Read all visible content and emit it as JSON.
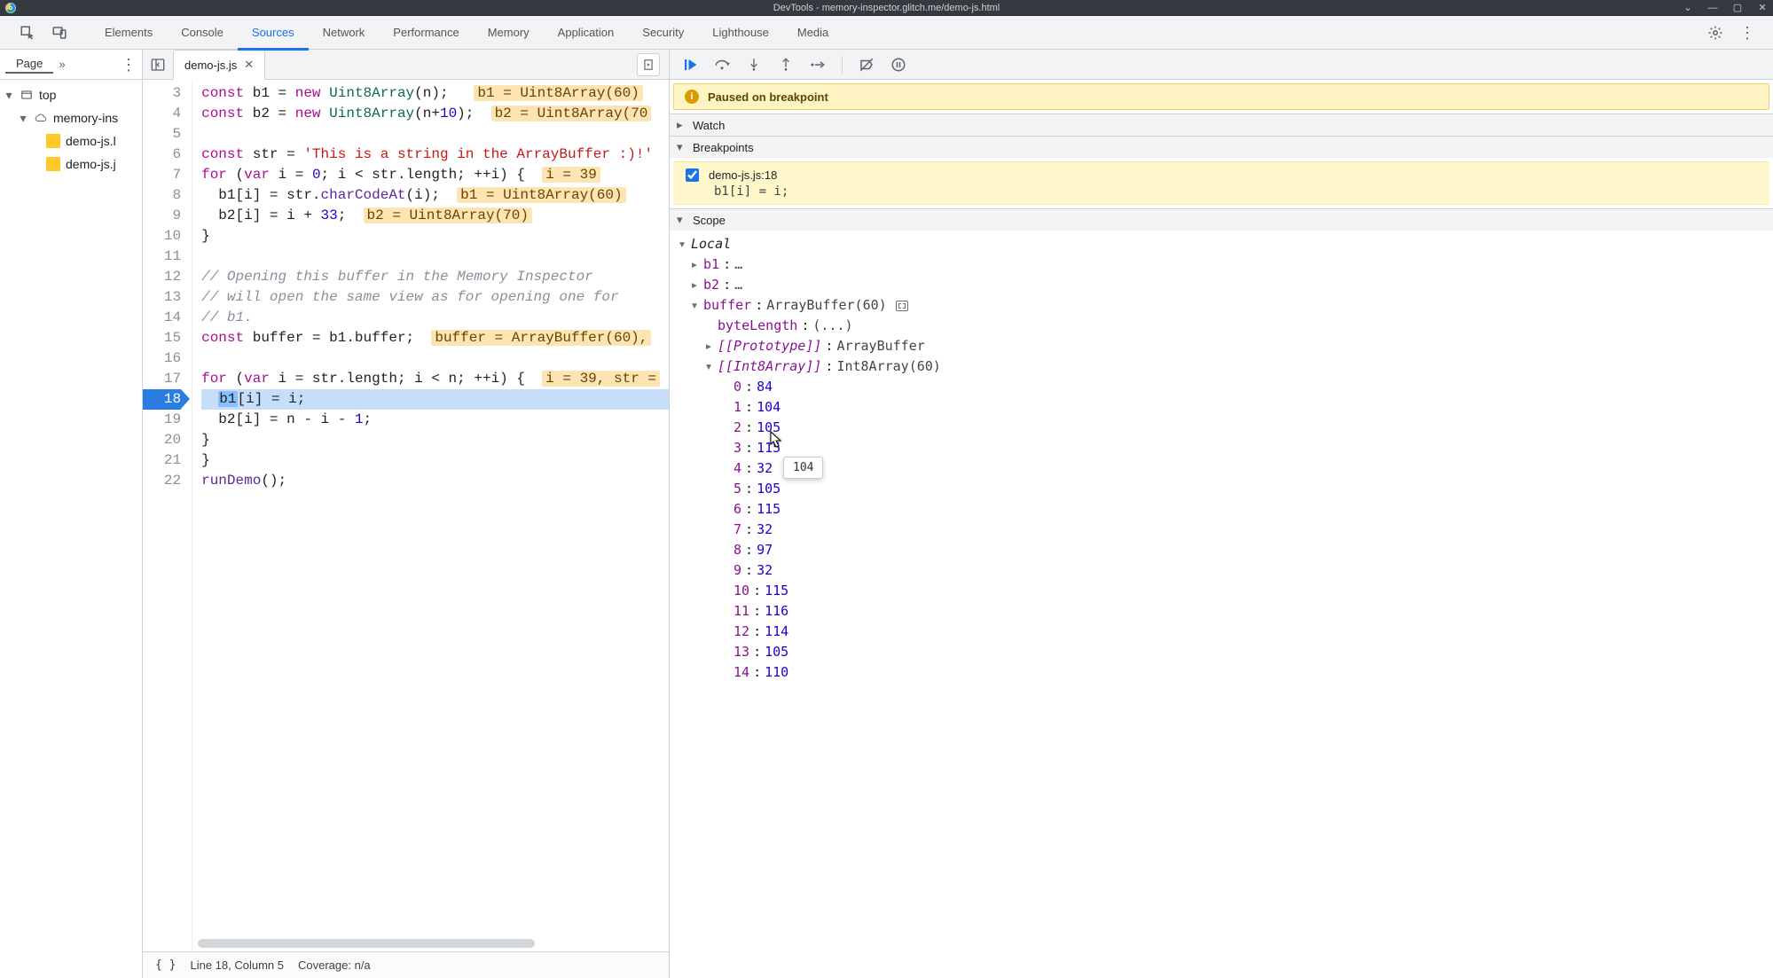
{
  "os_title": "DevTools - memory-inspector.glitch.me/demo-js.html",
  "tabs": [
    "Elements",
    "Console",
    "Sources",
    "Network",
    "Performance",
    "Memory",
    "Application",
    "Security",
    "Lighthouse",
    "Media"
  ],
  "active_tab_index": 2,
  "navigator": {
    "tab": "Page",
    "overflow": "»",
    "tree": {
      "top": "top",
      "origin": "memory-ins",
      "files": [
        "demo-js.l",
        "demo-js.j"
      ]
    }
  },
  "editor": {
    "open_file": "demo-js.js",
    "status_location": "Line 18, Column 5",
    "status_coverage": "Coverage: n/a",
    "current_line_index": 15,
    "lines": [
      {
        "n": 3,
        "html": "<span class='tok-kw'>const</span> b1 = <span class='tok-kw'>new</span> <span class='tok-ty'>Uint8Array</span>(n);   <span class='inline-hint'>b1 = Uint8Array(60)</span>"
      },
      {
        "n": 4,
        "html": "<span class='tok-kw'>const</span> b2 = <span class='tok-kw'>new</span> <span class='tok-ty'>Uint8Array</span>(n+<span class='tok-num'>10</span>);  <span class='inline-hint'>b2 = Uint8Array(70</span>"
      },
      {
        "n": 5,
        "html": ""
      },
      {
        "n": 6,
        "html": "<span class='tok-kw'>const</span> str = <span class='tok-str'>'This is a string in the ArrayBuffer :)!'</span>"
      },
      {
        "n": 7,
        "html": "<span class='tok-kw'>for</span> (<span class='tok-kw'>var</span> i = <span class='tok-num'>0</span>; i &lt; str.length; ++i) {  <span class='inline-hint'>i = 39</span>"
      },
      {
        "n": 8,
        "html": "  b1[i] = str.<span class='tok-fn'>charCodeAt</span>(i);  <span class='inline-hint'>b1 = Uint8Array(60)</span>"
      },
      {
        "n": 9,
        "html": "  b2[i] = i + <span class='tok-num'>33</span>;  <span class='inline-hint'>b2 = Uint8Array(70)</span>"
      },
      {
        "n": 10,
        "html": "}"
      },
      {
        "n": 11,
        "html": ""
      },
      {
        "n": 12,
        "html": "<span class='tok-cm'>// Opening this buffer in the Memory Inspector</span>"
      },
      {
        "n": 13,
        "html": "<span class='tok-cm'>// will open the same view as for opening one for</span>"
      },
      {
        "n": 14,
        "html": "<span class='tok-cm'>// b1.</span>"
      },
      {
        "n": 15,
        "html": "<span class='tok-kw'>const</span> buffer = b1.buffer;  <span class='inline-hint'>buffer = ArrayBuffer(60),</span>"
      },
      {
        "n": 16,
        "html": ""
      },
      {
        "n": 17,
        "html": "<span class='tok-kw'>for</span> (<span class='tok-kw'>var</span> i = str.length; i &lt; n; ++i) {  <span class='inline-hint'>i = 39, str =</span>"
      },
      {
        "n": 18,
        "html": "  <span class='cur-sel'>b1</span>[i] = i;"
      },
      {
        "n": 19,
        "html": "  b2[i] = n - i - <span class='tok-num'>1</span>;"
      },
      {
        "n": 20,
        "html": "}"
      },
      {
        "n": 21,
        "html": "}"
      },
      {
        "n": 22,
        "html": "<span class='tok-fn'>runDemo</span>();"
      }
    ]
  },
  "debugger": {
    "paused_text": "Paused on breakpoint",
    "panes": {
      "watch": "Watch",
      "breakpoints": "Breakpoints",
      "scope": "Scope"
    },
    "breakpoints": [
      {
        "checked": true,
        "location": "demo-js.js:18",
        "source": "b1[i] = i;"
      }
    ],
    "scope": {
      "local_label": "Local",
      "b1_label": "b1",
      "b2_label": "b2",
      "ellipsis": "…",
      "buffer_label": "buffer",
      "buffer_value": "ArrayBuffer(60)",
      "byteLength_label": "byteLength",
      "byteLength_value": "(...)",
      "proto_label": "[[Prototype]]",
      "proto_value": "ArrayBuffer",
      "int8_label": "[[Int8Array]]",
      "int8_value": "Int8Array(60)",
      "array": [
        {
          "i": 0,
          "v": 84
        },
        {
          "i": 1,
          "v": 104
        },
        {
          "i": 2,
          "v": 105
        },
        {
          "i": 3,
          "v": 115
        },
        {
          "i": 4,
          "v": 32
        },
        {
          "i": 5,
          "v": 105
        },
        {
          "i": 6,
          "v": 115
        },
        {
          "i": 7,
          "v": 32
        },
        {
          "i": 8,
          "v": 97
        },
        {
          "i": 9,
          "v": 32
        },
        {
          "i": 10,
          "v": 115
        },
        {
          "i": 11,
          "v": 116
        },
        {
          "i": 12,
          "v": 114
        },
        {
          "i": 13,
          "v": 105
        },
        {
          "i": 14,
          "v": 110
        }
      ]
    },
    "tooltip_value": "104"
  }
}
